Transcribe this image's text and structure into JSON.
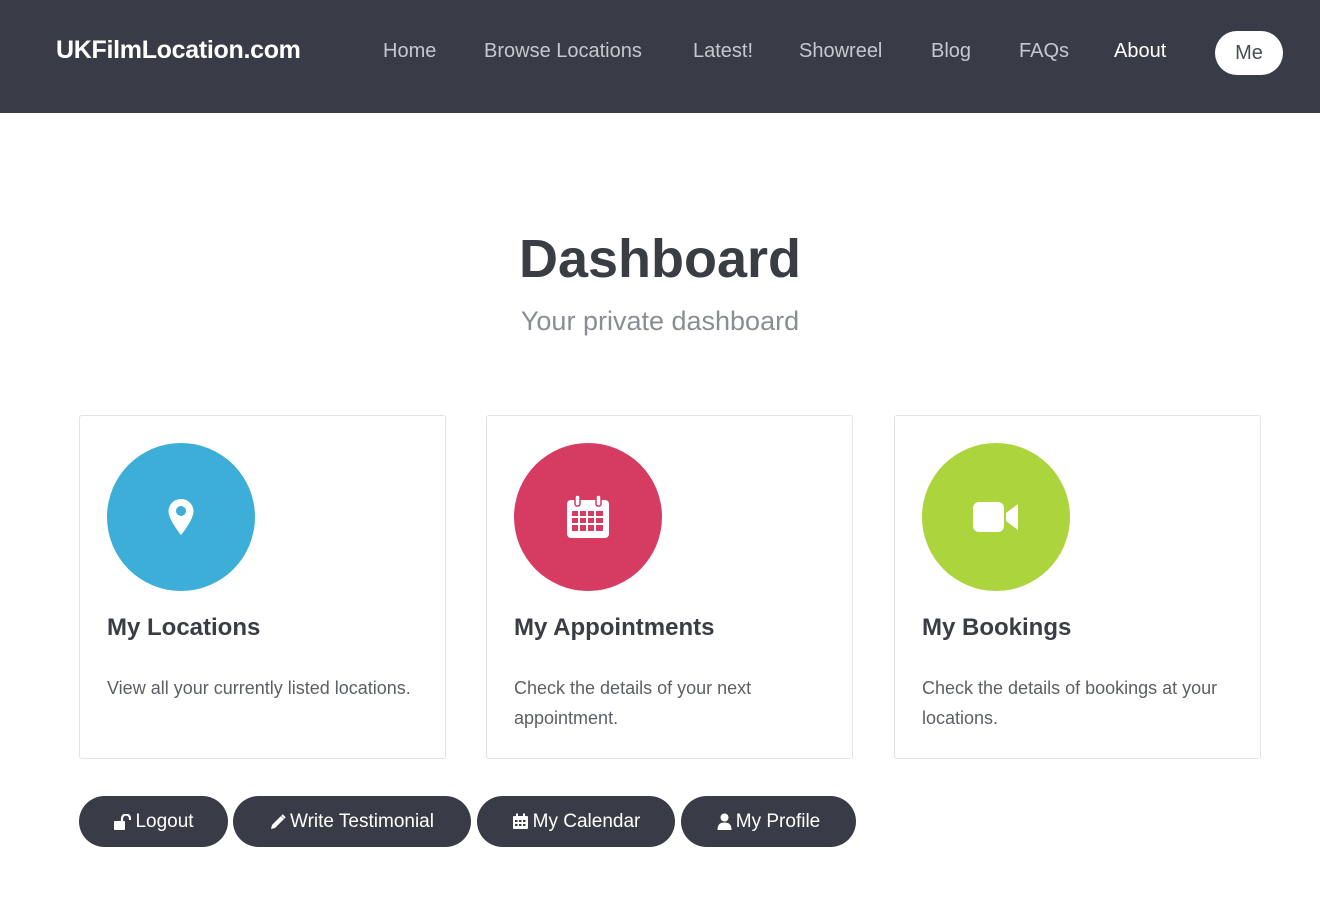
{
  "nav": {
    "brand": "UKFilmLocation.com",
    "links": [
      "Home",
      "Browse Locations",
      "Latest!",
      "Showreel",
      "Blog",
      "FAQs",
      "About"
    ],
    "me_label": "Me"
  },
  "header": {
    "title": "Dashboard",
    "subtitle": "Your private dashboard"
  },
  "cards": [
    {
      "title": "My Locations",
      "text": "View all your currently listed locations.",
      "color": "#3daed7",
      "icon": "map-marker-icon"
    },
    {
      "title": "My Appointments",
      "text": "Check the details of your next appointment.",
      "color": "#d63b61",
      "icon": "calendar-icon"
    },
    {
      "title": "My Bookings",
      "text": "Check the details of bookings at your locations.",
      "color": "#acd43c",
      "icon": "video-camera-icon"
    }
  ],
  "actions": [
    {
      "label": "Logout",
      "icon": "unlock-icon"
    },
    {
      "label": "Write Testimonial",
      "icon": "pencil-icon"
    },
    {
      "label": "My Calendar",
      "icon": "calendar-icon"
    },
    {
      "label": "My Profile",
      "icon": "user-icon"
    }
  ],
  "colors": {
    "navbar_bg": "#393c46",
    "button_bg": "#393c46"
  }
}
